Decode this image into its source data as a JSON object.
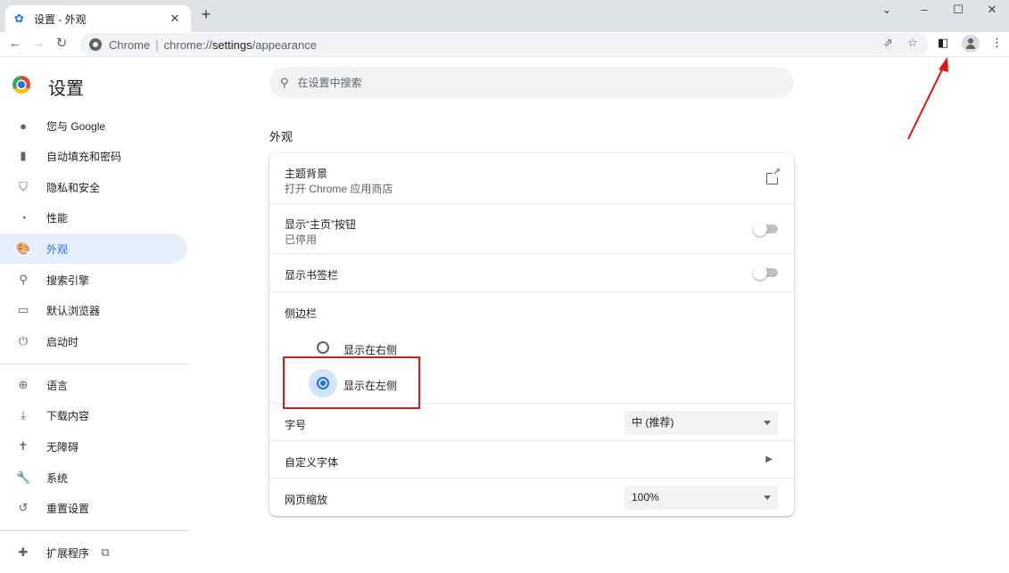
{
  "window": {
    "tab_title": "设置 - 外观",
    "tab_favicon": "gear-icon",
    "controls": [
      "chevron-down-icon",
      "minimize-icon",
      "maximize-icon",
      "close-icon"
    ]
  },
  "toolbar": {
    "omnibox_chrome_label": "Chrome",
    "omnibox_separator": "|",
    "url_scheme": "chrome://",
    "url_host": "settings",
    "url_path": "/appearance"
  },
  "sidebar": {
    "title": "设置",
    "items": [
      {
        "label": "您与 Google",
        "icon": "person-icon"
      },
      {
        "label": "自动填充和密码",
        "icon": "clipboard-icon"
      },
      {
        "label": "隐私和安全",
        "icon": "shield-icon"
      },
      {
        "label": "性能",
        "icon": "speedometer-icon"
      },
      {
        "label": "外观",
        "icon": "palette-icon",
        "selected": true
      },
      {
        "label": "搜索引擎",
        "icon": "search-icon"
      },
      {
        "label": "默认浏览器",
        "icon": "browser-icon"
      },
      {
        "label": "启动时",
        "icon": "power-icon"
      },
      {
        "label": "语言",
        "icon": "globe-icon"
      },
      {
        "label": "下载内容",
        "icon": "download-icon"
      },
      {
        "label": "无障碍",
        "icon": "accessibility-icon"
      },
      {
        "label": "系统",
        "icon": "wrench-icon"
      },
      {
        "label": "重置设置",
        "icon": "reset-icon"
      },
      {
        "label": "扩展程序",
        "icon": "puzzle-icon"
      }
    ]
  },
  "search": {
    "placeholder": "在设置中搜索"
  },
  "appearance": {
    "section_title": "外观",
    "theme": {
      "title": "主题背景",
      "subtitle": "打开 Chrome 应用商店"
    },
    "home_button": {
      "title": "显示“主页”按钮",
      "subtitle": "已停用",
      "enabled": false
    },
    "bookmarks_bar": {
      "title": "显示书签栏",
      "enabled": false
    },
    "side_panel": {
      "title": "侧边栏",
      "options": [
        {
          "label": "显示在右侧",
          "checked": false
        },
        {
          "label": "显示在左侧",
          "checked": true
        }
      ]
    },
    "font_size": {
      "title": "字号",
      "value": "中 (推荐)"
    },
    "custom_fonts": {
      "title": "自定义字体"
    },
    "page_zoom": {
      "title": "网页缩放",
      "value": "100%"
    }
  },
  "colors": {
    "accent": "#1a73e8",
    "annotation": "#e0151b"
  }
}
